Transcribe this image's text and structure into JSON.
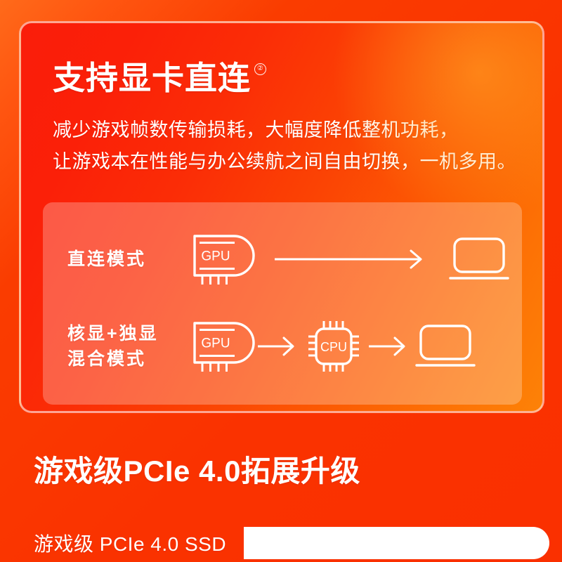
{
  "hero": {
    "headline": "支持显卡直连",
    "headline_footnote": "②",
    "subhead_line1": "减少游戏帧数传输损耗，大幅度降低整机功耗，",
    "subhead_line2": "让游戏本在性能与办公续航之间自由切换，一机多用。"
  },
  "modes": {
    "direct": {
      "label_line1": "直连模式",
      "label_line2": "",
      "gpu_icon_text": "GPU",
      "arrow_icon": "long-arrow-right-icon",
      "laptop_icon": "laptop-icon"
    },
    "hybrid": {
      "label_line1": "核显+独显",
      "label_line2": "混合模式",
      "gpu_icon_text": "GPU",
      "cpu_icon_text": "CPU",
      "arrow_icon": "arrow-right-icon",
      "laptop_icon": "laptop-icon"
    }
  },
  "bottom": {
    "heading": "游戏级PCIe 4.0拓展升级",
    "ssd_label": "游戏级 PCIe 4.0 SSD"
  },
  "colors": {
    "background_start": "#ff6a1a",
    "background_end": "#fa3000",
    "hero_card_start": "#fa1d0a",
    "hero_card_end": "#fd8207",
    "panel_overlay": "rgba(255,255,255,0.26)",
    "text": "#ffffff",
    "bar_fill": "#ffffff"
  }
}
